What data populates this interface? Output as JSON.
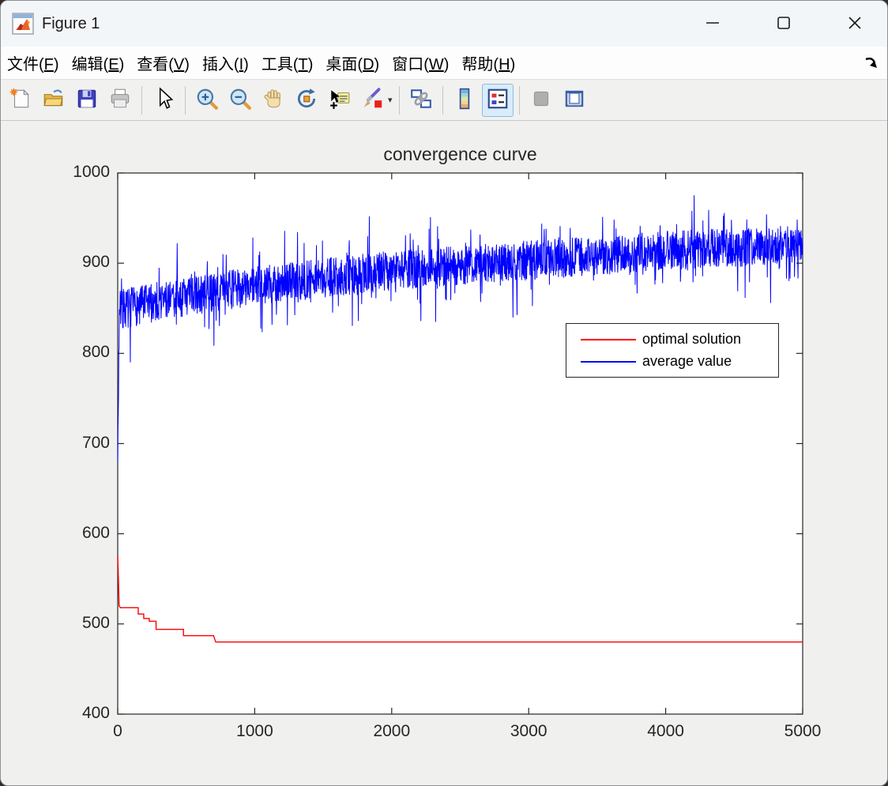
{
  "window": {
    "title": "Figure 1",
    "controls": [
      {
        "name": "minimize",
        "glyph": "minimize"
      },
      {
        "name": "maximize",
        "glyph": "maximize"
      },
      {
        "name": "close",
        "glyph": "close"
      }
    ]
  },
  "menu_bar": {
    "items": [
      {
        "label": "文件(F)"
      },
      {
        "label": "编辑(E)"
      },
      {
        "label": "查看(V)"
      },
      {
        "label": "插入(I)"
      },
      {
        "label": "工具(T)"
      },
      {
        "label": "桌面(D)"
      },
      {
        "label": "窗口(W)"
      },
      {
        "label": "帮助(H)"
      }
    ],
    "dock_icon": "dock-figure-arrow-icon"
  },
  "toolbar": {
    "items": [
      {
        "icon": "new-figure-icon",
        "name": "new-figure"
      },
      {
        "icon": "open-file-icon",
        "name": "open-file"
      },
      {
        "icon": "save-figure-icon",
        "name": "save-figure"
      },
      {
        "icon": "print-figure-icon",
        "name": "print-figure"
      },
      {
        "sep": true
      },
      {
        "icon": "edit-plot-arrow-icon",
        "name": "edit-plot"
      },
      {
        "sep": true
      },
      {
        "icon": "zoom-in-icon",
        "name": "zoom-in"
      },
      {
        "icon": "zoom-out-icon",
        "name": "zoom-out"
      },
      {
        "icon": "pan-hand-icon",
        "name": "pan"
      },
      {
        "icon": "rotate-3d-icon",
        "name": "rotate-3d"
      },
      {
        "icon": "data-cursor-icon",
        "name": "data-cursor"
      },
      {
        "icon": "brush-data-icon",
        "name": "brush-data",
        "dropdown": true
      },
      {
        "sep": true
      },
      {
        "icon": "link-plot-icon",
        "name": "link-plot"
      },
      {
        "sep": true
      },
      {
        "icon": "insert-colorbar-icon",
        "name": "insert-colorbar"
      },
      {
        "icon": "insert-legend-icon",
        "name": "insert-legend",
        "active": true
      },
      {
        "sep": true
      },
      {
        "icon": "hide-plot-tools-icon",
        "name": "hide-plot-tools",
        "disabled": true
      },
      {
        "icon": "show-plot-tools-icon",
        "name": "show-plot-tools-dock"
      }
    ]
  },
  "chart_data": {
    "type": "line",
    "title": "convergence curve",
    "xlabel": "",
    "ylabel": "",
    "xlim": [
      0,
      5000
    ],
    "ylim": [
      400,
      1000
    ],
    "xticks": [
      0,
      1000,
      2000,
      3000,
      4000,
      5000
    ],
    "yticks": [
      400,
      500,
      600,
      700,
      800,
      900,
      1000
    ],
    "grid": false,
    "box": true,
    "background": "#ffffff",
    "axes_color": "#262626",
    "legend": {
      "position": "right-center",
      "entries": [
        {
          "label": "optimal solution",
          "color": "#ff0000"
        },
        {
          "label": "average value",
          "color": "#0000ff"
        }
      ]
    },
    "series": [
      {
        "name": "optimal solution",
        "color": "#ff0000",
        "style": "step",
        "points": [
          [
            0,
            575
          ],
          [
            6,
            545
          ],
          [
            10,
            520
          ],
          [
            20,
            518
          ],
          [
            150,
            518
          ],
          [
            150,
            511
          ],
          [
            190,
            511
          ],
          [
            190,
            506
          ],
          [
            230,
            506
          ],
          [
            230,
            503
          ],
          [
            280,
            503
          ],
          [
            280,
            494
          ],
          [
            480,
            494
          ],
          [
            480,
            487
          ],
          [
            700,
            487
          ],
          [
            715,
            480
          ],
          [
            5000,
            480
          ]
        ]
      },
      {
        "name": "average value",
        "color": "#0000ff",
        "style": "noisy-line",
        "trend": [
          [
            0,
            680
          ],
          [
            12,
            848
          ],
          [
            300,
            858
          ],
          [
            1000,
            875
          ],
          [
            2000,
            892
          ],
          [
            3000,
            903
          ],
          [
            4000,
            914
          ],
          [
            5000,
            921
          ]
        ],
        "noise_base": 22,
        "noise_spike_prob": 0.1,
        "noise_spike_factor": 1.9,
        "noise_big_spike_prob": 0.025,
        "noise_big_spike_factor": 2.9,
        "points_count": 2500,
        "seed": 7
      }
    ]
  }
}
